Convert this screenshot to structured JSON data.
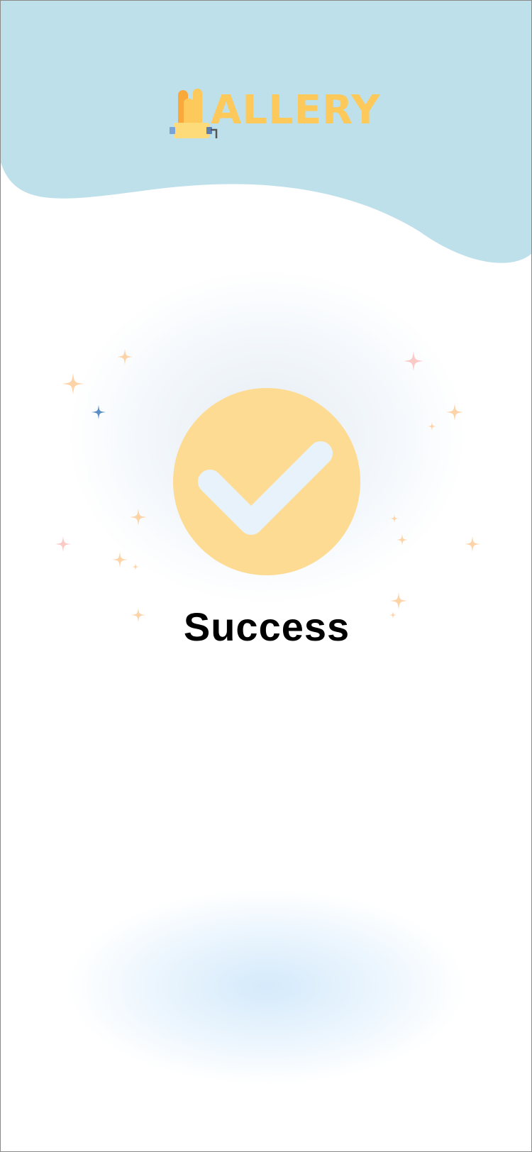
{
  "app": {
    "logo_text": "ALLERY"
  },
  "status": {
    "title": "Success"
  },
  "colors": {
    "header_bg": "#bee0ea",
    "brand_yellow": "#fdc95b",
    "badge_fill": "#fedb93",
    "check_mark": "#e8f2fa",
    "title_text": "#000000"
  },
  "icons": {
    "logo": "hand-sign-icon",
    "badge": "checkmark-icon",
    "decoration": "sparkle-icon"
  }
}
